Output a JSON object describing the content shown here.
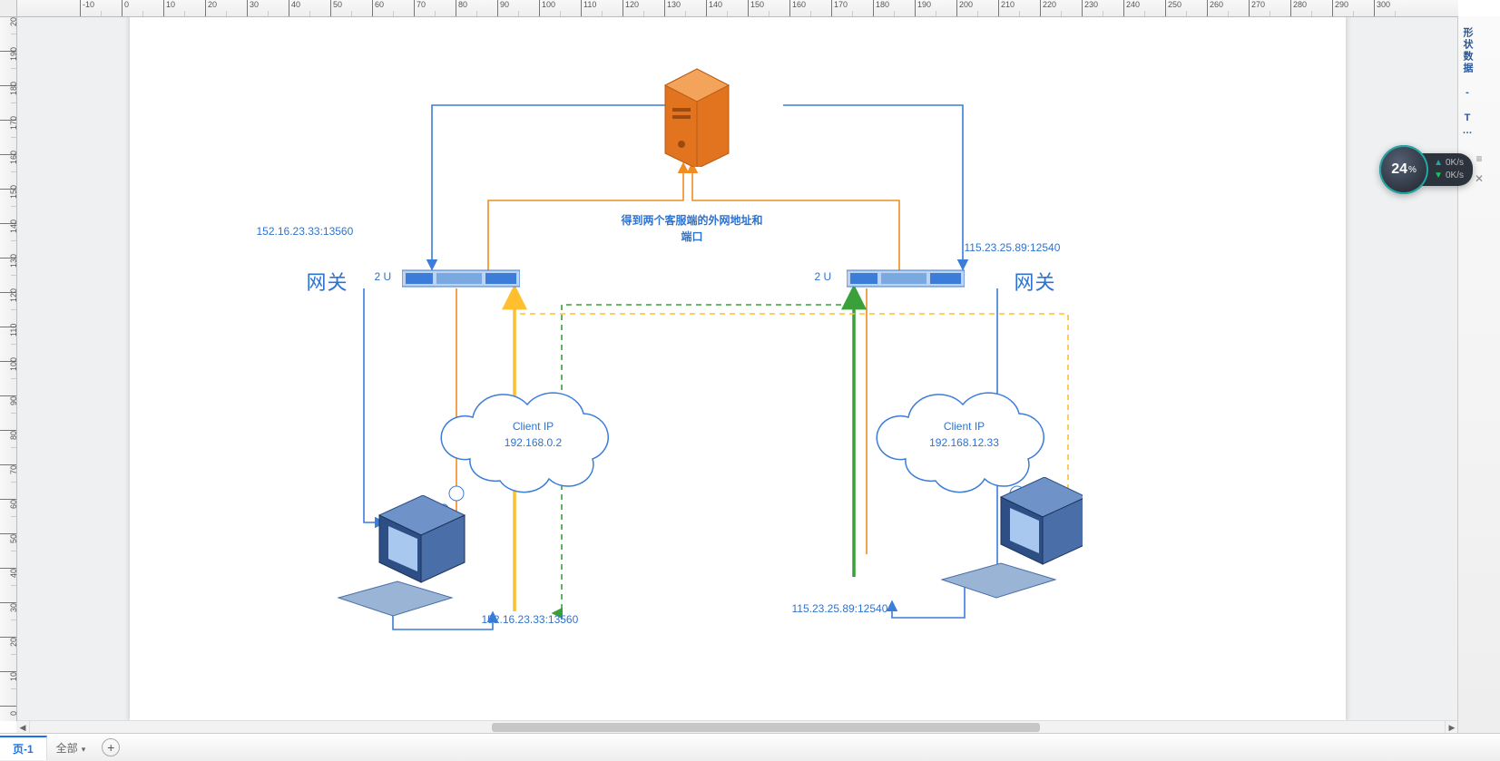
{
  "ruler": {
    "h_ticks": [
      -10,
      0,
      10,
      20,
      30,
      40,
      50,
      60,
      70,
      80,
      90,
      100,
      110,
      120,
      130,
      140,
      150,
      160,
      170,
      180,
      190,
      200,
      210,
      220,
      230,
      240,
      250,
      260,
      270,
      280,
      290,
      300
    ],
    "v_ticks": [
      200,
      190,
      180,
      170,
      160,
      150,
      140,
      130,
      120,
      110,
      100,
      90,
      80,
      70,
      60,
      50,
      40,
      30,
      20,
      10,
      0
    ]
  },
  "side_panel": {
    "title": "形状数据 - T…",
    "collapse": "≡",
    "close": "✕"
  },
  "tab_bar": {
    "page_label": "页-1",
    "scope_label": "全部",
    "add_tooltip": "+"
  },
  "gauge": {
    "percent": "24",
    "unit": "%",
    "up": "0K/s",
    "down": "0K/s"
  },
  "diagram": {
    "left_gateway_label": "网关",
    "right_gateway_label": "网关",
    "left_rack_label": "2 U",
    "right_rack_label": "2 U",
    "server_caption_l1": "得到两个客服端的外网地址和",
    "server_caption_l2": "端口",
    "left_nat_top": "152.16.23.33:13560",
    "right_nat_top": "115.23.25.89:12540",
    "left_nat_bottom": "152.16.23.33:13560",
    "right_nat_bottom": "115.23.25.89:12540",
    "left_client_ip_l1": "Client IP",
    "left_client_ip_l2": "192.168.0.2",
    "right_client_ip_l1": "Client IP",
    "right_client_ip_l2": "192.168.12.33",
    "colors": {
      "blue": "#3b7dd8",
      "orange": "#f08c22",
      "green": "#3aa03a",
      "yellow": "#ffbf2e",
      "server_fill": "#e2741f"
    }
  }
}
